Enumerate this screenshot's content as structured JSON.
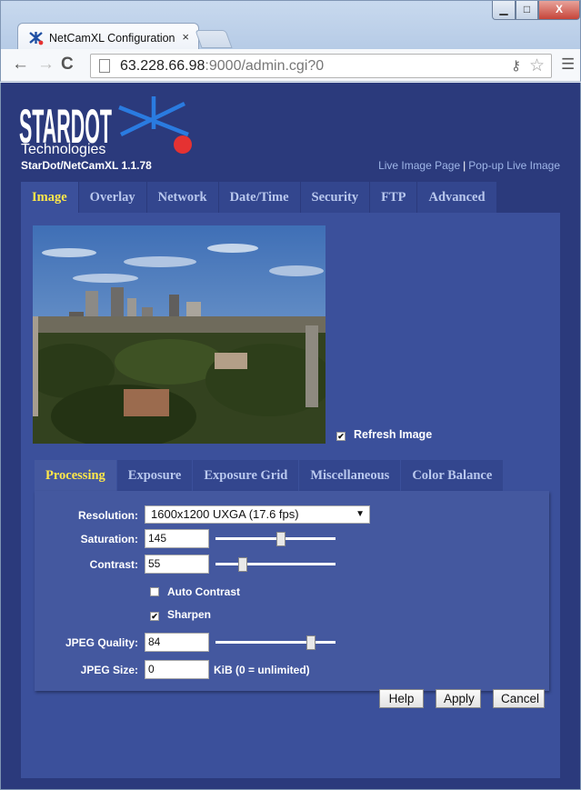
{
  "browser": {
    "tab_title": "NetCamXL Configuration",
    "tab_close": "×",
    "url_host": "63.228.66.98",
    "url_rest": ":9000/admin.cgi?0",
    "window_min": "▁",
    "window_max": "□",
    "window_close": "X"
  },
  "header": {
    "logo_text": "STARDOT",
    "logo_sub": "Technologies",
    "model": "StarDot/NetCamXL 1.1.78",
    "live_link": "Live Image Page",
    "link_sep": "|",
    "popup_link": "Pop-up Live Image"
  },
  "main_tabs": [
    "Image",
    "Overlay",
    "Network",
    "Date/Time",
    "Security",
    "FTP",
    "Advanced"
  ],
  "image_panel": {
    "refresh_label": "Refresh Image",
    "refresh_checked": true
  },
  "sub_tabs": [
    "Processing",
    "Exposure",
    "Exposure Grid",
    "Miscellaneous",
    "Color Balance"
  ],
  "processing": {
    "resolution_label": "Resolution:",
    "resolution_value": "1600x1200 UXGA (17.6 fps)",
    "saturation_label": "Saturation:",
    "saturation_value": "145",
    "contrast_label": "Contrast:",
    "contrast_value": "55",
    "auto_contrast_label": "Auto Contrast",
    "auto_contrast_checked": false,
    "sharpen_label": "Sharpen",
    "sharpen_checked": true,
    "jpeg_quality_label": "JPEG Quality:",
    "jpeg_quality_value": "84",
    "jpeg_size_label": "JPEG Size:",
    "jpeg_size_value": "0",
    "jpeg_size_suffix": "KiB (0 = unlimited)"
  },
  "buttons": {
    "help": "Help",
    "apply": "Apply",
    "cancel": "Cancel"
  },
  "colors": {
    "page_bg": "#2b3a7c",
    "panel_bg": "#3b509b",
    "active_tab_text": "#ffe84a",
    "logo_red": "#e53232",
    "logo_blue": "#2a7be0"
  }
}
